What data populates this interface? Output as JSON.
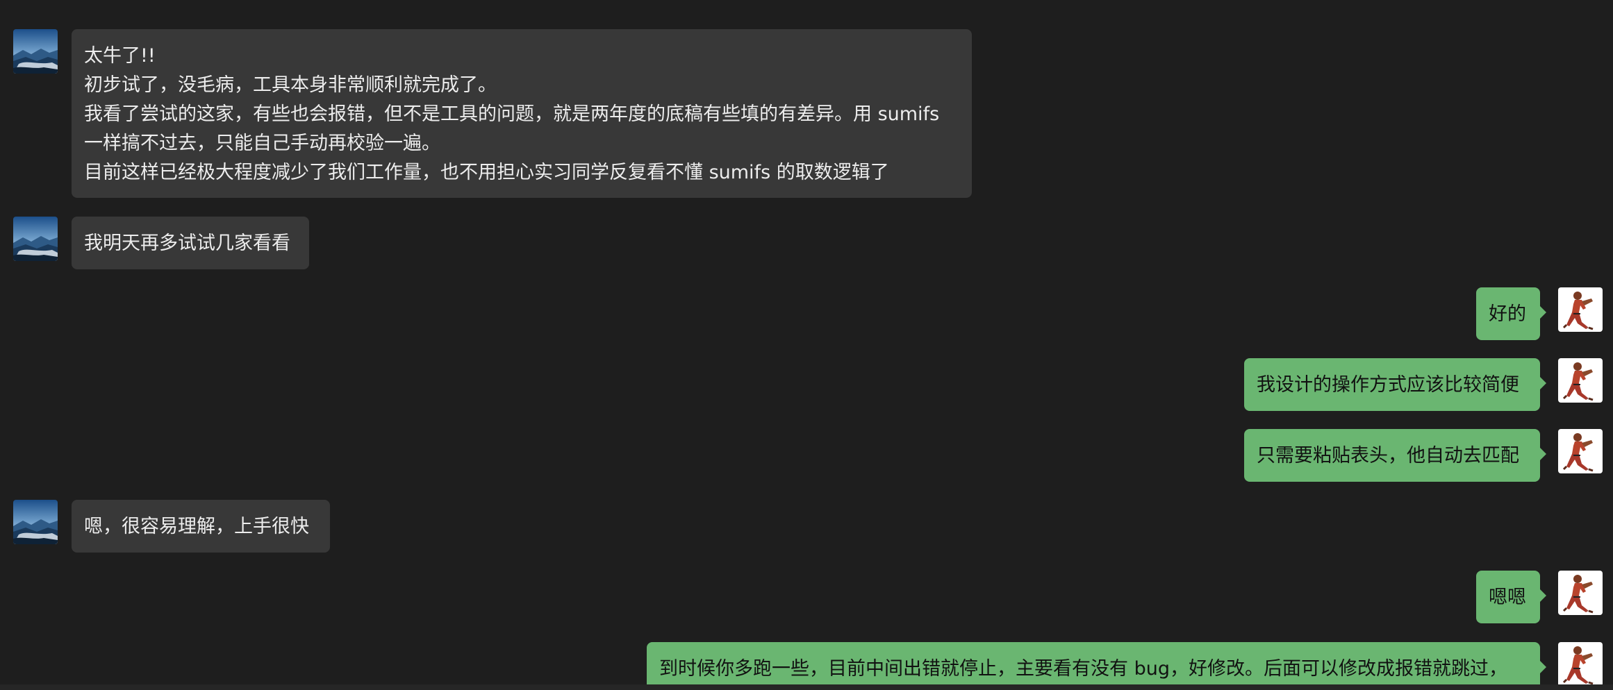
{
  "chat": {
    "messages": [
      {
        "sender": "them",
        "lines": [
          "太牛了!!",
          "初步试了，没毛病，工具本身非常顺利就完成了。",
          "我看了尝试的这家，有些也会报错，但不是工具的问题，就是两年度的底稿有些填的有差异。用 sumifs",
          "一样搞不过去，只能自己手动再校验一遍。",
          "目前这样已经极大程度减少了我们工作量，也不用担心实习同学反复看不懂 sumifs 的取数逻辑了"
        ]
      },
      {
        "sender": "them",
        "text": "我明天再多试试几家看看"
      },
      {
        "sender": "me",
        "text": "好的"
      },
      {
        "sender": "me",
        "text": "我设计的操作方式应该比较简便"
      },
      {
        "sender": "me",
        "text": "只需要粘贴表头，他自动去匹配"
      },
      {
        "sender": "them",
        "text": "嗯，很容易理解，上手很快"
      },
      {
        "sender": "me",
        "text": "嗯嗯"
      },
      {
        "sender": "me",
        "text": "到时候你多跑一些，目前中间出错就停止，主要看有没有 bug，好修改。后面可以修改成报错就跳过，"
      }
    ]
  },
  "colors": {
    "background": "#1e1e1e",
    "incoming_bubble": "#383838",
    "outgoing_bubble": "#6ab671",
    "incoming_text": "#ededed",
    "outgoing_text": "#111111"
  },
  "icons": {
    "contact_avatar": "landscape-avatar-icon",
    "self_avatar": "fighter-avatar-icon"
  }
}
